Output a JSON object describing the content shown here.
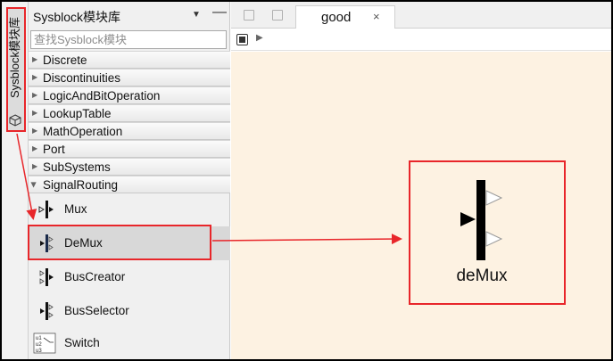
{
  "side_tab": {
    "label": "Sysblock模块库",
    "icon": "cube-icon"
  },
  "library": {
    "title": "Sysblock模块库",
    "search": {
      "placeholder": "查找Sysblock模块",
      "value": ""
    },
    "categories": [
      {
        "label": "Discrete",
        "expanded": false
      },
      {
        "label": "Discontinuities",
        "expanded": false
      },
      {
        "label": "LogicAndBitOperation",
        "expanded": false
      },
      {
        "label": "LookupTable",
        "expanded": false
      },
      {
        "label": "MathOperation",
        "expanded": false
      },
      {
        "label": "Port",
        "expanded": false
      },
      {
        "label": "SubSystems",
        "expanded": false
      },
      {
        "label": "SignalRouting",
        "expanded": true
      }
    ],
    "items": [
      {
        "label": "Mux",
        "icon": "mux-icon"
      },
      {
        "label": "DeMux",
        "icon": "demux-icon",
        "selected": true
      },
      {
        "label": "BusCreator",
        "icon": "bus-creator-icon"
      },
      {
        "label": "BusSelector",
        "icon": "bus-selector-icon"
      },
      {
        "label": "Switch",
        "icon": "switch-icon",
        "ports": [
          "u1",
          "u2",
          "u3"
        ]
      }
    ]
  },
  "editor": {
    "tab": {
      "label": "good",
      "close": "×"
    },
    "canvas_block": {
      "label": "deMux"
    }
  },
  "colors": {
    "highlight": "#e8262a",
    "canvas": "#fdf2e2",
    "selected_row": "#d8d8d8"
  }
}
